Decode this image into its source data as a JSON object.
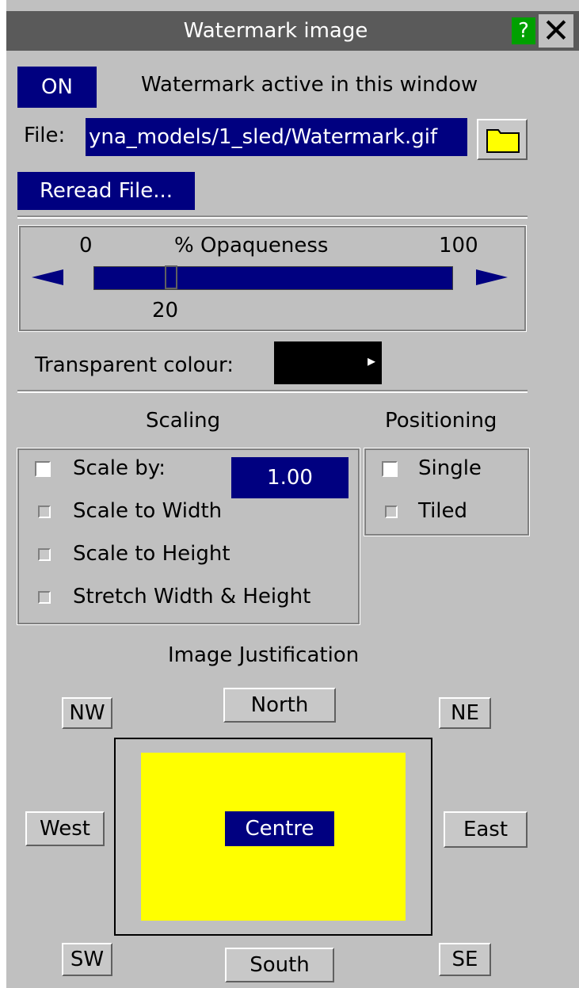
{
  "window": {
    "title": "Watermark image",
    "help_label": "?",
    "close_label": "✕"
  },
  "watermark": {
    "on_label": "ON",
    "active_text": "Watermark active in this window"
  },
  "file": {
    "label": "File:",
    "value": "yna_models/1_sled/Watermark.gif",
    "reread_label": "Reread File..."
  },
  "opaqueness": {
    "min_label": "0",
    "title": "% Opaqueness",
    "max_label": "100",
    "value": 20,
    "value_label": "20"
  },
  "transparent_colour": {
    "label": "Transparent colour:",
    "arrow": "▸",
    "color": "#000000"
  },
  "scaling": {
    "title": "Scaling",
    "options": [
      {
        "label": "Scale by:",
        "checked": true
      },
      {
        "label": "Scale to Width",
        "checked": false
      },
      {
        "label": "Scale to Height",
        "checked": false
      },
      {
        "label": "Stretch Width & Height",
        "checked": false
      }
    ],
    "scale_value": "1.00"
  },
  "positioning": {
    "title": "Positioning",
    "options": [
      {
        "label": "Single",
        "checked": true
      },
      {
        "label": "Tiled",
        "checked": false
      }
    ]
  },
  "justification": {
    "title": "Image Justification",
    "nw": "NW",
    "north": "North",
    "ne": "NE",
    "west": "West",
    "centre": "Centre",
    "east": "East",
    "sw": "SW",
    "south": "South",
    "se": "SE",
    "image_color": "#ffff00"
  },
  "icons": {
    "folder": "folder-icon",
    "slider_left": "arrow-left-icon",
    "slider_right": "arrow-right-icon"
  }
}
